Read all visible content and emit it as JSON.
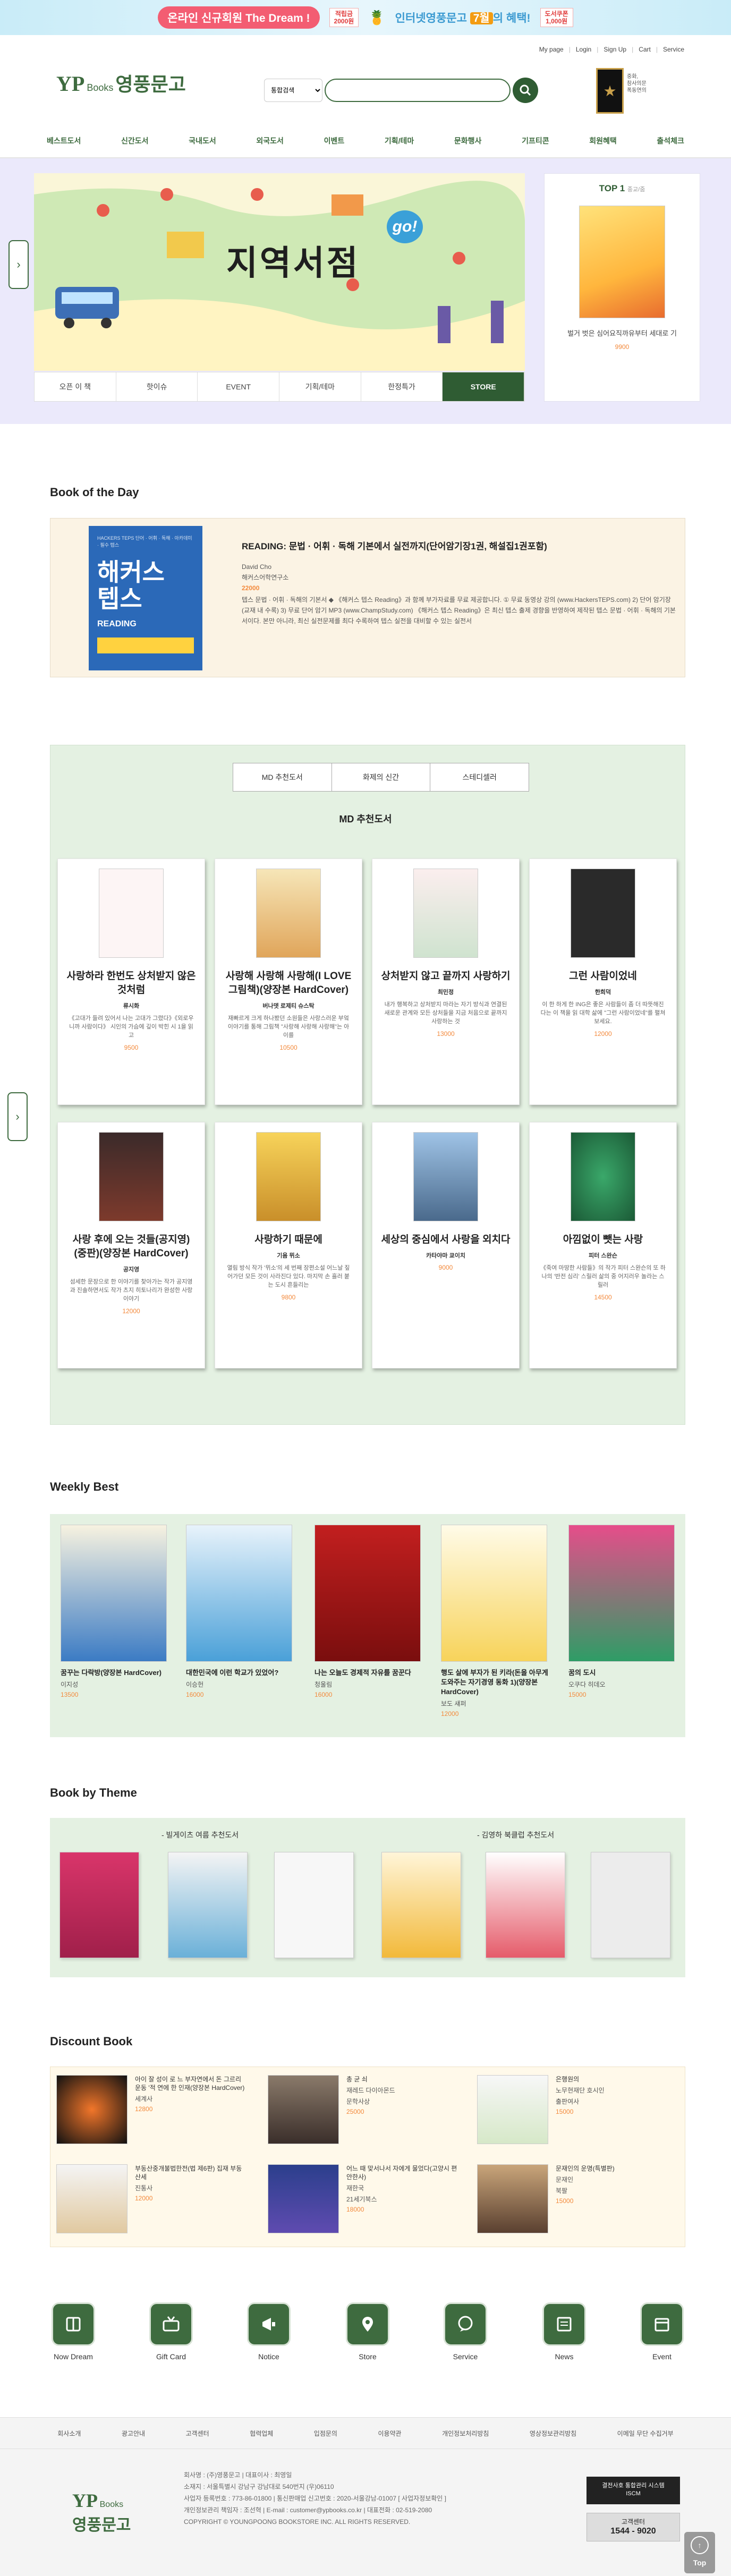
{
  "banner": {
    "text1": "온라인 신규회원 The Dream !",
    "coupon1": "적립금\n2000원",
    "text2_pre": "인터넷영풍문고 ",
    "text2_hl": "7월",
    "text2_post": "의 혜택!",
    "coupon2": "도서쿠폰\n1,000원"
  },
  "util": [
    "My page",
    "Login",
    "Sign Up",
    "Cart",
    "Service"
  ],
  "logo": {
    "yp": "YP",
    "books": "Books",
    "kr": "영풍문고"
  },
  "search": {
    "select": "통합검색",
    "placeholder": ""
  },
  "ad": {
    "text": "중화,\n참사의문\n폭동연의"
  },
  "gnb": [
    "베스트도서",
    "신간도서",
    "국내도서",
    "외국도서",
    "이벤트",
    "기획/테마",
    "문화행사",
    "기프티콘",
    "회원혜택",
    "출석체크"
  ],
  "hero": {
    "title": "지역서점",
    "go": "go!",
    "tabs": [
      "오픈 이 책",
      "핫이슈",
      "EVENT",
      "기획/테마",
      "한정특가",
      "STORE"
    ]
  },
  "top1": {
    "title": "TOP 1",
    "sub": "종교/줌",
    "book": "벌거 벗은 심어요직까유부터 세대로 기",
    "price": "9900"
  },
  "botd": {
    "heading": "Book of the Day",
    "cover_top": "HACKERS TEPS 단어 · 어휘 · 독해 · 아카데미 · 필수 텝스",
    "cover_big": "해커스\n텝스",
    "cover_reading": "READING",
    "title": "READING: 문법 · 어휘 · 독해 기본에서 실전까지(단어암기장1권, 해설집1권포함)",
    "author": "David Cho",
    "publisher": "해커스어학연구소",
    "price": "22000",
    "desc": "텝스 문법 · 어휘 · 독해의 기본서 ◆ 《해커스 텝스 Reading》과 함께 부가자료를 무료 제공합니다. ① 무료 동영상 강의 (www.HackersTEPS.com) 2) 단어 암기장 (교재 내 수록) 3) 무료 단어 암기 MP3 (www.ChampStudy.com) 《해커스 텝스 Reading》은 최신 텝스 출제 경향을 반영하여 제작된 텝스 문법 · 어휘 · 독해의 기본서이다. 본만 아니라, 최신 실전문제를 최다 수록하여 텝스 실전을 대비할 수 있는 실전서"
  },
  "md": {
    "tabs": [
      "MD 추천도서",
      "화제의 신간",
      "스테디셀러"
    ],
    "title": "MD 추천도서",
    "books": [
      {
        "name": "사랑하라 한번도 상처받지 않은 것처럼",
        "author": "류시화",
        "desc": "《고대가 들려 있어서 나는 고대가 그렸다》《외로우니까 사람이다》 시인의 가슴에 깊이 박힌 시 1을 읽고",
        "price": "9500"
      },
      {
        "name": "사랑해 사랑해 사랑해(I LOVE 그림책)(양장본 HardCover)",
        "author": "버나뎃 로제티 슈스탁",
        "desc": "재빠르게 크게 하나봤던 소원들은 사랑스러운 부엌 이야기를 통해 그림책 \"사랑해 사랑해 사랑해\"는 아이를",
        "price": "10500"
      },
      {
        "name": "상처받지 않고 끝까지 사랑하기",
        "author": "최민정",
        "desc": "내가 행복하고 상처받지 마라는 자기 방식과 연결된 새로운 관계와 모든 상처들을 지금 처음으로 끝까지 사랑하는 것",
        "price": "13000"
      },
      {
        "name": "그런 사람이었네",
        "author": "한희덕",
        "desc": "이 한 하게 한 ING은 좋은 사람들이 좀 더 따뜻해진다는 이 책을 읽 대학 삶에 \"그런 사람이었네\"를 펼쳐 보세요.",
        "price": "12000"
      },
      {
        "name": "사랑 후에 오는 것들(공지영)(중판)(양장본 HardCover)",
        "author": "공지영",
        "desc": "섬세한 문장으로 한 이야기를 찾아가는 작가 공지영과 진솔하면서도 작가 츠지 히토나리가 완성한 사랑 이야기",
        "price": "12000"
      },
      {
        "name": "사랑하기 때문에",
        "author": "기욤 뮈소",
        "desc": "열림 방식 작가 '뮈소'의 세 번째 장편소설 어느날 짚어가던 모든 것이 사라진다 있다. 마지막 손 흘러 붙는 도시 흔들리는",
        "price": "9800"
      },
      {
        "name": "세상의 중심에서 사랑을 외치다",
        "author": "카타야마 쿄이치",
        "desc": "",
        "price": "9000"
      },
      {
        "name": "아낌없이 뺏는 사랑",
        "author": "피터 스완슨",
        "desc": "《죽여 마땅한 사람들》의 작가 피터 스완슨의 또 하나의 '반전 심리' 스릴러 삶의 중 어지러우 놀라는 스릴러",
        "price": "14500"
      }
    ]
  },
  "weekly": {
    "heading": "Weekly Best",
    "books": [
      {
        "name": "꿈꾸는 다락방(양장본 HardCover)",
        "author": "이지성",
        "price": "13500"
      },
      {
        "name": "대한민국에 이런 학교가 있었어?",
        "author": "이승헌",
        "price": "16000"
      },
      {
        "name": "나는 오늘도 경제적 자유를 꿈꾼다",
        "author": "청울림",
        "price": "16000"
      },
      {
        "name": "행도 살에 부자가 된 키라(돈을 아무게 도와주는 자기경영 동화 1)(양장본 HardCover)",
        "author": "보도 섀퍼",
        "price": "12000"
      },
      {
        "name": "꿈의 도시",
        "author": "오쿠다 히데오",
        "price": "15000"
      }
    ]
  },
  "theme": {
    "heading": "Book by Theme",
    "left_label": "- 빌게이츠 여름 추천도서",
    "right_label": "- 김영하 북클럽 추천도서"
  },
  "discount": {
    "heading": "Discount Book",
    "items": [
      {
        "name": "아이 잘 성이 로 느 부자연에서 돈 그르리 운동 '적 연에 한 인재(양장본 HardCover)",
        "author": "세계사",
        "price": "12800"
      },
      {
        "name": "총 균 쇠",
        "author": "재레드 다이아몬드",
        "extra": "문학사상",
        "price": "25000"
      },
      {
        "name": "은행원의",
        "author": "노무현재단 호시인",
        "extra": "출판여사",
        "price": "15000"
      },
      {
        "name": "부동산중개불법한전(법 제6판) 집재 부동산세",
        "author": "진통사",
        "price": "12000"
      },
      {
        "name": "어느 때 맞서나서 자에게 물었다(고양시 편 안한사)",
        "author": "재한국",
        "extra": "21세기북스",
        "price": "18000"
      },
      {
        "name": "문재인의 운명(특별판)",
        "author": "문재인",
        "extra": "북팔",
        "price": "15000"
      }
    ]
  },
  "quick": [
    "Now Dream",
    "Gift Card",
    "Notice",
    "Store",
    "Service",
    "News",
    "Event"
  ],
  "footer": {
    "links": [
      "회사소개",
      "광고안내",
      "고객센터",
      "협력업체",
      "입점문의",
      "이용약관",
      "개인정보처리방침",
      "영상정보관리방침",
      "이메일 무단 수집거부"
    ],
    "logo_yp": "YP",
    "logo_books": "Books",
    "logo_kr": "영풍문고",
    "info": [
      "회사명 : (주)영풍문고  |  대표이사 : 최영일",
      "소재지 : 서울특별시 강남구 강남대로 540번지 (우)06110",
      "사업자 등록번호 : 773-86-01800  |  통신판매업 신고번호 : 2020-서울강남-01007  [ 사업자정보확인 ]",
      "개인정보관리 책임자 : 조선혁  |  E-mail : customer@ypbooks.co.kr  |  대표전화 : 02-519-2080",
      "COPYRIGHT © YOUNGPOONG BOOKSTORE INC. ALL RIGHTS RESERVED."
    ],
    "box1": "결전사호 통합관리 시스템\nISCM",
    "box2_label": "고객센터",
    "box2_num": "1544 - 9020",
    "top": "Top"
  }
}
